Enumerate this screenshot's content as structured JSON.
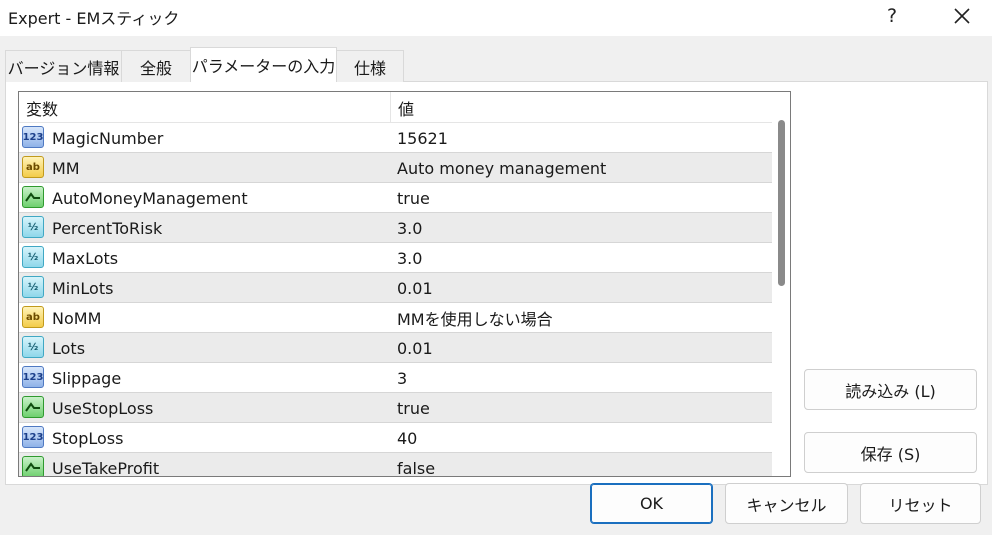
{
  "window": {
    "title": "Expert - EMスティック",
    "help_label": "?"
  },
  "tabs": [
    {
      "label": "バージョン情報"
    },
    {
      "label": "全般"
    },
    {
      "label": "パラメーターの入力"
    },
    {
      "label": "仕様"
    }
  ],
  "list": {
    "header_variable": "変数",
    "header_value": "値",
    "rows": [
      {
        "icon": "123",
        "type": "int",
        "name": "MagicNumber",
        "value": "15621"
      },
      {
        "icon": "ab",
        "type": "string",
        "name": "MM",
        "value": "Auto money management"
      },
      {
        "icon": "bool-icon",
        "type": "bool",
        "name": "AutoMoneyManagement",
        "value": "true"
      },
      {
        "icon": "½",
        "type": "double",
        "name": "PercentToRisk",
        "value": "3.0"
      },
      {
        "icon": "½",
        "type": "double",
        "name": "MaxLots",
        "value": "3.0"
      },
      {
        "icon": "½",
        "type": "double",
        "name": "MinLots",
        "value": "0.01"
      },
      {
        "icon": "ab",
        "type": "string",
        "name": "NoMM",
        "value": "MMを使用しない場合"
      },
      {
        "icon": "½",
        "type": "double",
        "name": "Lots",
        "value": "0.01"
      },
      {
        "icon": "123",
        "type": "int",
        "name": "Slippage",
        "value": "3"
      },
      {
        "icon": "bool-icon",
        "type": "bool",
        "name": "UseStopLoss",
        "value": "true"
      },
      {
        "icon": "123",
        "type": "int",
        "name": "StopLoss",
        "value": "40"
      },
      {
        "icon": "bool-icon",
        "type": "bool",
        "name": "UseTakeProfit",
        "value": "false"
      }
    ]
  },
  "side_buttons": {
    "load_label": "読み込み (L)",
    "save_label": "保存 (S)"
  },
  "footer_buttons": {
    "ok_label": "OK",
    "cancel_label": "キャンセル",
    "reset_label": "リセット"
  },
  "colors": {
    "selected_tab_bg": "#ffffff",
    "alt_row_bg": "#ebebeb",
    "primary_border": "#1a6fbf"
  }
}
